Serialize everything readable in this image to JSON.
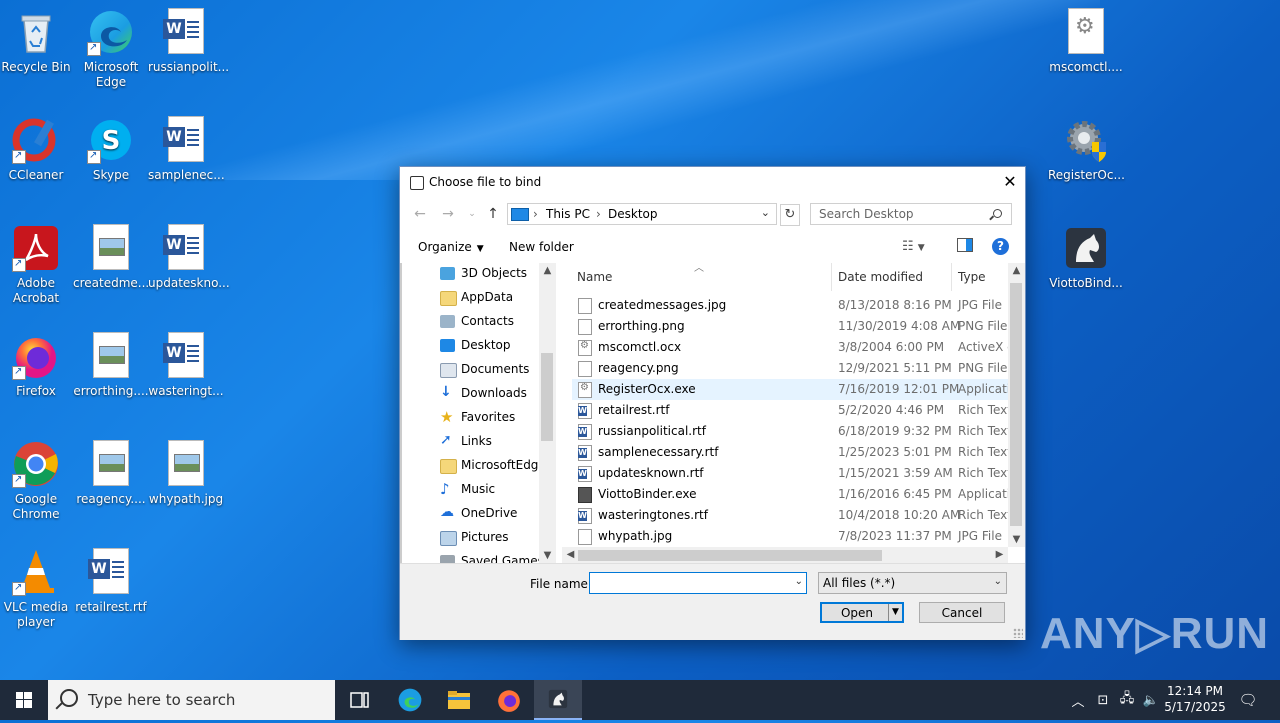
{
  "desktop": {
    "icons": [
      {
        "label": "Recycle Bin"
      },
      {
        "label": "Microsoft Edge"
      },
      {
        "label": "russianpolit..."
      },
      {
        "label": "CCleaner"
      },
      {
        "label": "Skype"
      },
      {
        "label": "samplenec..."
      },
      {
        "label": "Adobe Acrobat"
      },
      {
        "label": "createdme..."
      },
      {
        "label": "updateskno..."
      },
      {
        "label": "Firefox"
      },
      {
        "label": "errorthing...."
      },
      {
        "label": "wasteringt..."
      },
      {
        "label": "Google Chrome"
      },
      {
        "label": "reagency...."
      },
      {
        "label": "whypath.jpg"
      },
      {
        "label": "VLC media player"
      },
      {
        "label": "retailrest.rtf"
      },
      {
        "label": "mscomctl...."
      },
      {
        "label": "RegisterOc..."
      },
      {
        "label": "ViottoBind..."
      }
    ]
  },
  "dialog": {
    "title": "Choose file to bind",
    "close_glyph": "✕",
    "address": {
      "root": "This PC",
      "sep": "›",
      "folder": "Desktop"
    },
    "search_placeholder": "Search Desktop",
    "organize_label": "Organize",
    "new_folder_label": "New folder",
    "nav_items": [
      {
        "label": "3D Objects"
      },
      {
        "label": "AppData"
      },
      {
        "label": "Contacts"
      },
      {
        "label": "Desktop"
      },
      {
        "label": "Documents"
      },
      {
        "label": "Downloads"
      },
      {
        "label": "Favorites"
      },
      {
        "label": "Links"
      },
      {
        "label": "MicrosoftEdge"
      },
      {
        "label": "Music"
      },
      {
        "label": "OneDrive"
      },
      {
        "label": "Pictures"
      },
      {
        "label": "Saved Games"
      }
    ],
    "columns": {
      "name": "Name",
      "date": "Date modified",
      "type": "Type"
    },
    "files": [
      {
        "name": "createdmessages.jpg",
        "date": "8/13/2018 8:16 PM",
        "type": "JPG File"
      },
      {
        "name": "errorthing.png",
        "date": "11/30/2019 4:08 AM",
        "type": "PNG File"
      },
      {
        "name": "mscomctl.ocx",
        "date": "3/8/2004 6:00 PM",
        "type": "ActiveX c"
      },
      {
        "name": "reagency.png",
        "date": "12/9/2021 5:11 PM",
        "type": "PNG File"
      },
      {
        "name": "RegisterOcx.exe",
        "date": "7/16/2019 12:01 PM",
        "type": "Applicatio"
      },
      {
        "name": "retailrest.rtf",
        "date": "5/2/2020 4:46 PM",
        "type": "Rich Text"
      },
      {
        "name": "russianpolitical.rtf",
        "date": "6/18/2019 9:32 PM",
        "type": "Rich Text"
      },
      {
        "name": "samplenecessary.rtf",
        "date": "1/25/2023 5:01 PM",
        "type": "Rich Text"
      },
      {
        "name": "updatesknown.rtf",
        "date": "1/15/2021 3:59 AM",
        "type": "Rich Text"
      },
      {
        "name": "ViottoBinder.exe",
        "date": "1/16/2016 6:45 PM",
        "type": "Applicatio"
      },
      {
        "name": "wasteringtones.rtf",
        "date": "10/4/2018 10:20 AM",
        "type": "Rich Text"
      },
      {
        "name": "whypath.jpg",
        "date": "7/8/2023 11:37 PM",
        "type": "JPG File"
      }
    ],
    "file_name_label": "File name:",
    "file_name_value": "",
    "filter_value": "All files (*.*)",
    "open_label": "Open",
    "cancel_label": "Cancel"
  },
  "taskbar": {
    "search_placeholder": "Type here to search",
    "clock_time": "12:14 PM",
    "clock_date": "5/17/2025"
  },
  "watermark": "ANY▷RUN",
  "colors": {
    "accent": "#0078d7",
    "desktop": "#1a86e8",
    "taskbar": "#1f2a3a"
  }
}
